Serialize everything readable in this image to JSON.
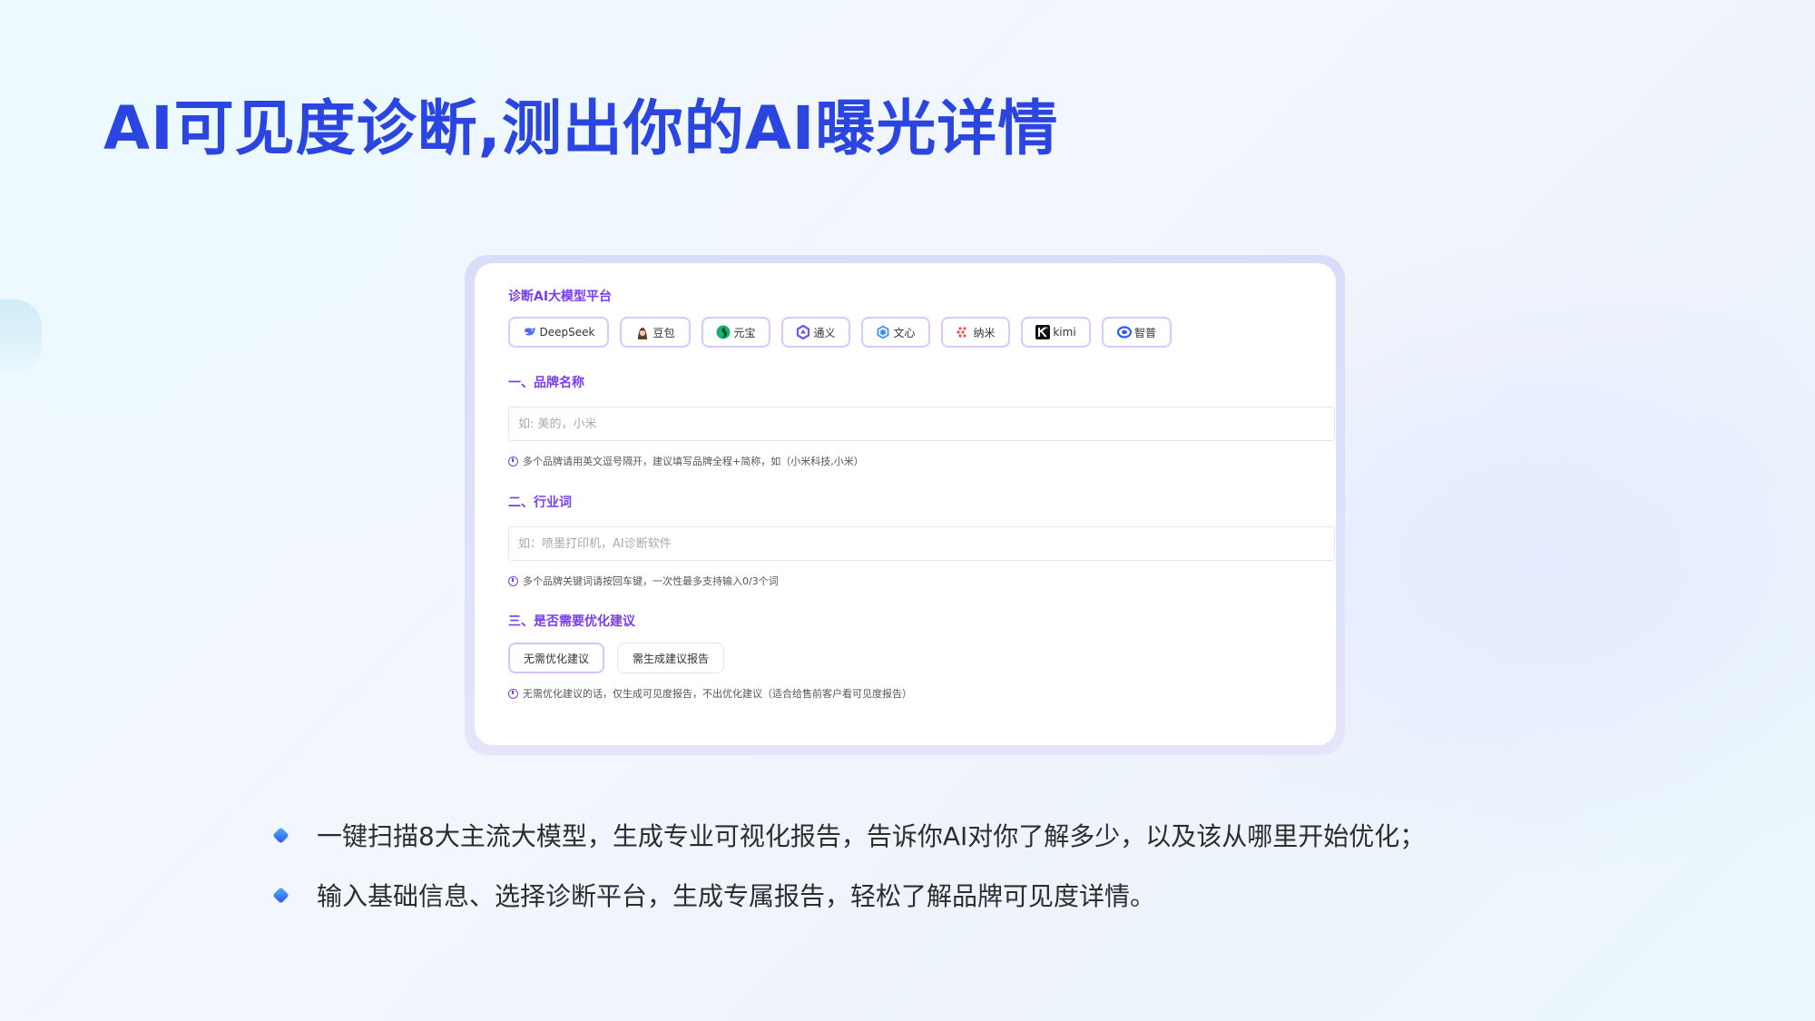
{
  "slide": {
    "title": "AI可见度诊断,测出你的AI曝光详情"
  },
  "form": {
    "platform_section": {
      "title": "诊断AI大模型平台",
      "platforms": [
        {
          "label": "DeepSeek",
          "icon": "deepseek-whale-icon"
        },
        {
          "label": "豆包",
          "icon": "doubao-avatar-icon"
        },
        {
          "label": "元宝",
          "icon": "yuanbao-icon"
        },
        {
          "label": "通义",
          "icon": "tongyi-icon"
        },
        {
          "label": "文心",
          "icon": "wenxin-icon"
        },
        {
          "label": "纳米",
          "icon": "nami-icon"
        },
        {
          "label": "kimi",
          "icon": "kimi-icon"
        },
        {
          "label": "智普",
          "icon": "zhipu-icon"
        }
      ]
    },
    "brand": {
      "title": "一、品牌名称",
      "placeholder": "如: 美的，小米",
      "hint": "多个品牌请用英文逗号隔开，建议填写品牌全程+简称，如（小米科技,小米）"
    },
    "industry": {
      "title": "二、行业词",
      "placeholder": "如：喷墨打印机，AI诊断软件",
      "hint": "多个品牌关键词请按回车键，一次性最多支持输入0/3个词"
    },
    "optimization": {
      "title": "三、是否需要优化建议",
      "options": [
        "无需优化建议",
        "需生成建议报告"
      ],
      "selected": "无需优化建议",
      "hint": "无需优化建议的话，仅生成可见度报告，不出优化建议（适合给售前客户看可见度报告）"
    }
  },
  "bullets": [
    "一键扫描8大主流大模型，生成专业可视化报告，告诉你AI对你了解多少，以及该从哪里开始优化；",
    "输入基础信息、选择诊断平台，生成专属报告，轻松了解品牌可见度详情。"
  ],
  "colors": {
    "title_blue": "#2b45e0",
    "accent_purple": "#7a3df0",
    "chip_border": "#dcc8fa"
  }
}
